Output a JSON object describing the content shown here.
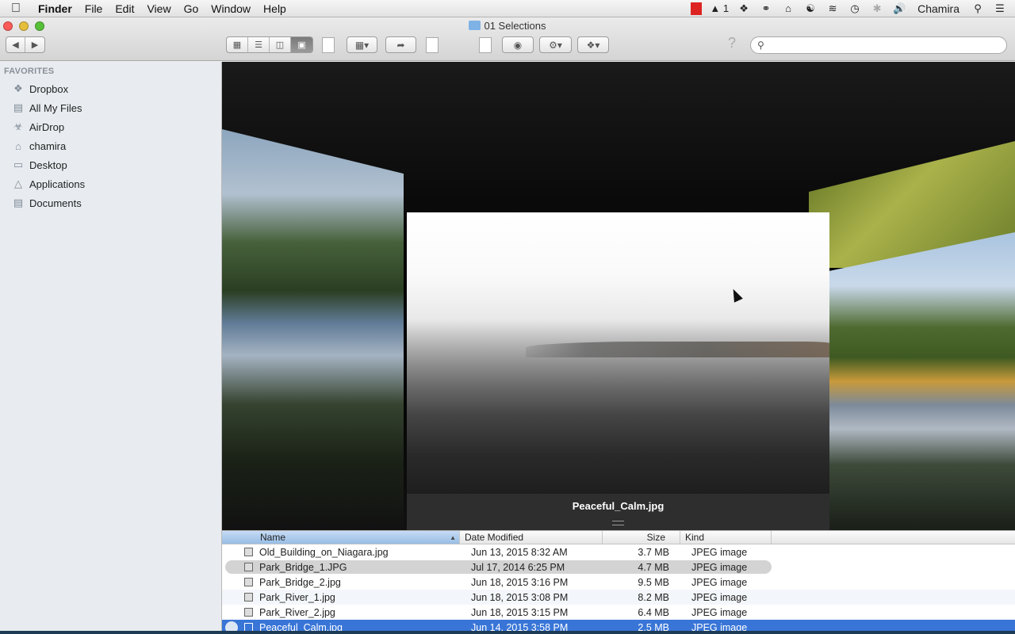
{
  "menubar": {
    "apple_icon": "apple-icon",
    "app_name": "Finder",
    "menus": [
      "File",
      "Edit",
      "View",
      "Go",
      "Window",
      "Help"
    ],
    "status_items": [
      "adobe-icon",
      "1",
      "dropbox-icon",
      "creative-cloud-icon",
      "home-icon",
      "evernote-icon",
      "wifi-icon",
      "time-machine-icon",
      "bluetooth-icon",
      "volume-icon"
    ],
    "user": "Chamira",
    "spotlight_icon": "magnifier-icon",
    "notification_icon": "list-icon"
  },
  "window": {
    "title": "01 Selections",
    "search": {
      "placeholder": "",
      "value": ""
    }
  },
  "sidebar": {
    "section_title": "FAVORITES",
    "items": [
      {
        "label": "Dropbox",
        "icon": "dropbox-icon"
      },
      {
        "label": "All My Files",
        "icon": "all-files-icon"
      },
      {
        "label": "AirDrop",
        "icon": "airdrop-icon"
      },
      {
        "label": "chamira",
        "icon": "home-icon"
      },
      {
        "label": "Desktop",
        "icon": "desktop-icon"
      },
      {
        "label": "Applications",
        "icon": "applications-icon"
      },
      {
        "label": "Documents",
        "icon": "documents-icon"
      }
    ]
  },
  "coverflow": {
    "current_caption": "Peaceful_Calm.jpg"
  },
  "list": {
    "columns": {
      "name": "Name",
      "date": "Date Modified",
      "size": "Size",
      "kind": "Kind"
    },
    "rows": [
      {
        "name": "Old_Building_on_Niagara.jpg",
        "date": "Jun 13, 2015 8:32 AM",
        "size": "3.7 MB",
        "kind": "JPEG image"
      },
      {
        "name": "Park_Bridge_1.JPG",
        "date": "Jul 17, 2014 6:25 PM",
        "size": "4.7 MB",
        "kind": "JPEG image"
      },
      {
        "name": "Park_Bridge_2.jpg",
        "date": "Jun 18, 2015 3:16 PM",
        "size": "9.5 MB",
        "kind": "JPEG image"
      },
      {
        "name": "Park_River_1.jpg",
        "date": "Jun 18, 2015 3:08 PM",
        "size": "8.2 MB",
        "kind": "JPEG image"
      },
      {
        "name": "Park_River_2.jpg",
        "date": "Jun 18, 2015 3:15 PM",
        "size": "6.4 MB",
        "kind": "JPEG image"
      },
      {
        "name": "Peaceful_Calm.jpg",
        "date": "Jun 14, 2015 3:58 PM",
        "size": "2.5 MB",
        "kind": "JPEG image"
      }
    ]
  },
  "colors": {
    "selection": "#3875d7",
    "sidebar_bg": "#e8ecf0"
  }
}
